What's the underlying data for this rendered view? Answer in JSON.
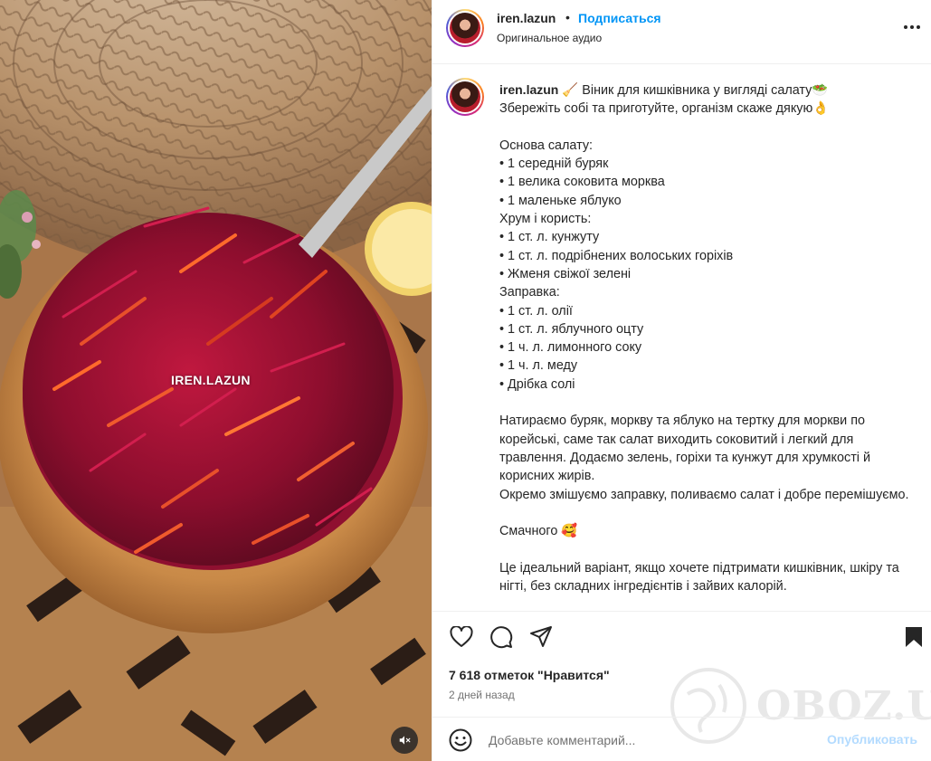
{
  "media": {
    "watermark": "IREN.LAZUN",
    "mute_icon": "speaker-muted-icon"
  },
  "header": {
    "username": "iren.lazun",
    "separator": "•",
    "follow_label": "Подписаться",
    "audio_label": "Оригинальное аудио",
    "more_icon": "more-options-icon"
  },
  "caption": {
    "username": "iren.lazun",
    "text": "🧹 Віник для кишківника у вигляді салату🥗\nЗбережіть собі та приготуйте, організм скаже дякую👌\n\nОснова салату:\n• 1 середній буряк\n• 1 велика соковита морква\n• 1 маленьке яблуко\nХрум і користь:\n• 1 ст. л. кунжуту\n• 1 ст. л. подрібнених волоських горіхів\n• Жменя свіжої зелені\nЗаправка:\n• 1 ст. л. олії\n• 1 ст. л. яблучного оцту\n• 1 ч. л. лимонного соку\n• 1 ч. л. меду\n• Дрібка солі\n\nНатираємо буряк, моркву та яблуко на тертку для моркви по корейські, саме так салат виходить соковитий і легкий для травлення. Додаємо зелень, горіхи та кунжут для хрумкості й корисних жирів.\nОкремо змішуємо заправку, поливаємо салат і добре перемішуємо.\n\nСмачного 🥰\n\nЦе ідеальний варіант, якщо хочете підтримати кишківник, шкіру та нігті, без складних інгредієнтів і зайвих калорій."
  },
  "actions": {
    "icons": [
      "heart-icon",
      "comment-icon",
      "share-icon",
      "bookmark-icon"
    ],
    "likes": "7 618 отметок \"Нравится\"",
    "time": "2 дней назад"
  },
  "watermark_logo": {
    "text": "OBOZ.UA"
  },
  "comment": {
    "placeholder": "Добавьте комментарий...",
    "publish_label": "Опубликовать"
  }
}
